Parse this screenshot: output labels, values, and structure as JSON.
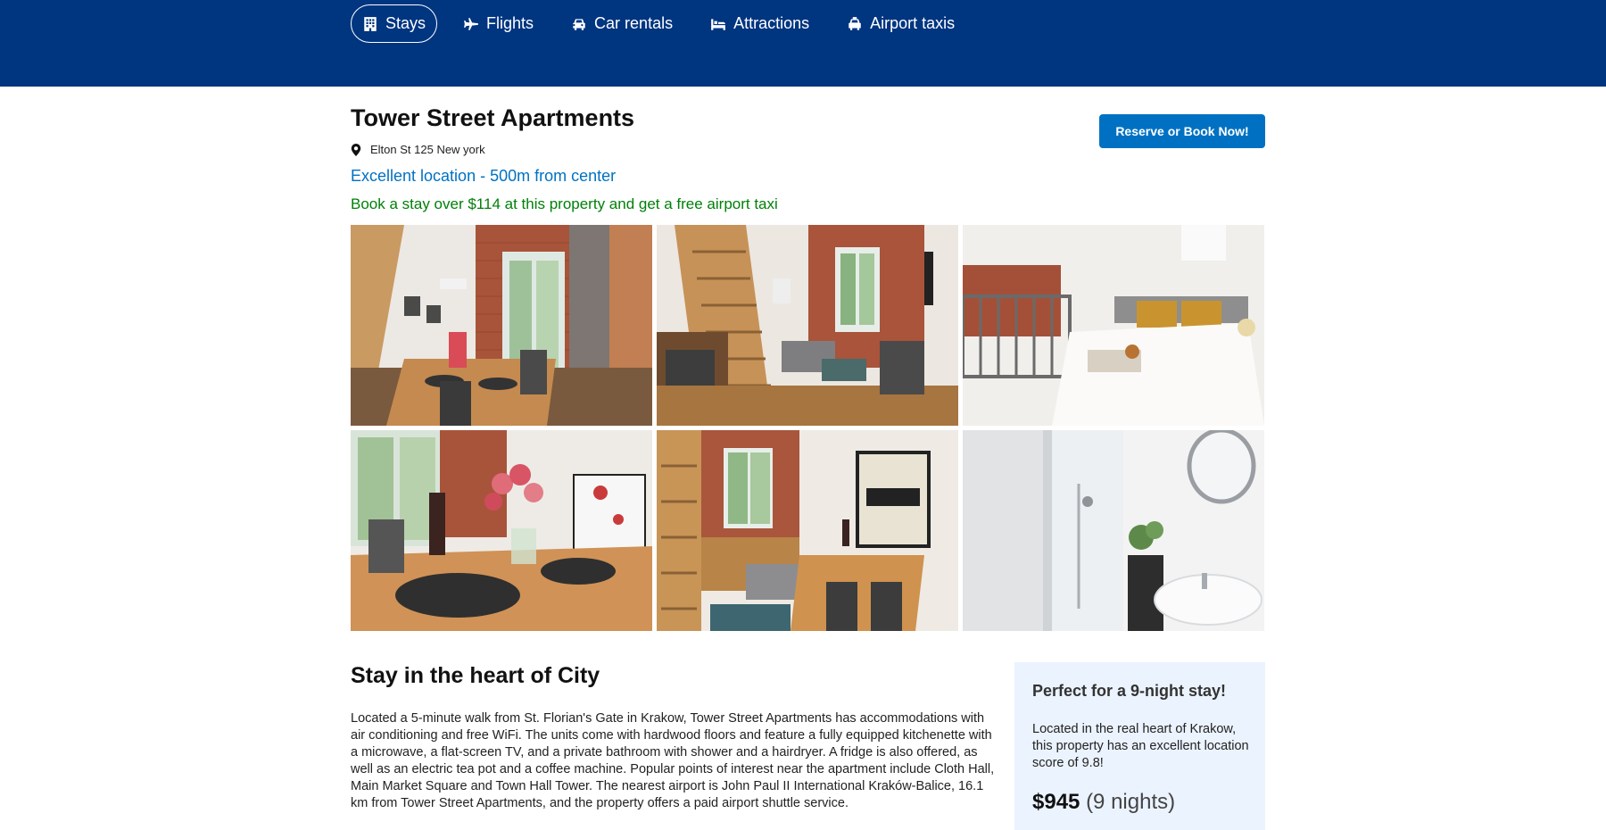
{
  "nav": {
    "items": [
      {
        "label": "Stays",
        "icon": "building-icon",
        "active": true
      },
      {
        "label": "Flights",
        "icon": "plane-icon"
      },
      {
        "label": "Car rentals",
        "icon": "car-icon"
      },
      {
        "label": "Attractions",
        "icon": "bed-icon"
      },
      {
        "label": "Airport taxis",
        "icon": "taxi-icon"
      }
    ]
  },
  "hotel": {
    "title": "Tower Street Apartments",
    "address": "Elton St 125 New york",
    "location_note": "Excellent location - 500m from center",
    "promo": "Book a stay over $114 at this property and get a free airport taxi",
    "book_button": "Reserve or Book Now!"
  },
  "gallery": {
    "photos": [
      "living-dining-room",
      "kitchenette-stairs",
      "loft-bedroom",
      "dining-table-flowers",
      "living-room-poster",
      "bathroom"
    ]
  },
  "details": {
    "title": "Stay in the heart of City",
    "description": "Located a 5-minute walk from St. Florian's Gate in Krakow, Tower Street Apartments has accommodations with air conditioning and free WiFi. The units come with hardwood floors and feature a fully equipped kitchenette with a microwave, a flat-screen TV, and a private bathroom with shower and a hairdryer. A fridge is also offered, as well as an electric tea pot and a coffee machine. Popular points of interest near the apartment include Cloth Hall, Main Market Square and Town Hall Tower. The nearest airport is John Paul II International Kraków-Balice, 16.1 km from Tower Street Apartments, and the property offers a paid airport shuttle service."
  },
  "summary": {
    "title": "Perfect for a 9-night stay!",
    "text": "Located in the real heart of Krakow, this property has an excellent location score of 9.8!",
    "price": "$945",
    "nights": "(9 nights)"
  },
  "colors": {
    "header": "#003580",
    "primary": "#0071c2",
    "promo": "#008009",
    "side_box": "#ebf3ff"
  }
}
